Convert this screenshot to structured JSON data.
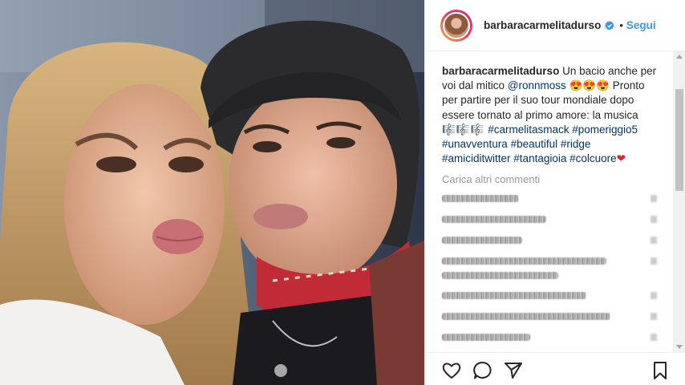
{
  "header": {
    "username": "barbaracarmelitadurso",
    "dot": "•",
    "follow_label": "Segui"
  },
  "caption": {
    "username": "barbaracarmelitadurso",
    "text1": "Un bacio anche per voi dal mitico",
    "mention": "@ronnmoss",
    "emojis1": "😍😍😍",
    "text2": "Pronto per partire per il suo tour mondiale dopo essere tornato al primo amore: la musica",
    "music_emojis": "🎼🎼🎼",
    "hashtags": [
      "#carmelitasmack",
      "#pomeriggio5",
      "#unavventura",
      "#beautiful",
      "#ridge",
      "#amiciditwitter",
      "#tantagioia",
      "#colcuore"
    ],
    "heart": "❤"
  },
  "load_more_label": "Carica altri commenti",
  "icons": {
    "like": "heart-outline-icon",
    "comment": "speech-bubble-icon",
    "share": "paper-plane-icon",
    "save": "bookmark-icon",
    "verified": "verified-badge-icon"
  },
  "colors": {
    "link": "#003569",
    "follow": "#3897f0",
    "verified": "#3897f0",
    "text": "#262626",
    "muted": "#999999"
  }
}
